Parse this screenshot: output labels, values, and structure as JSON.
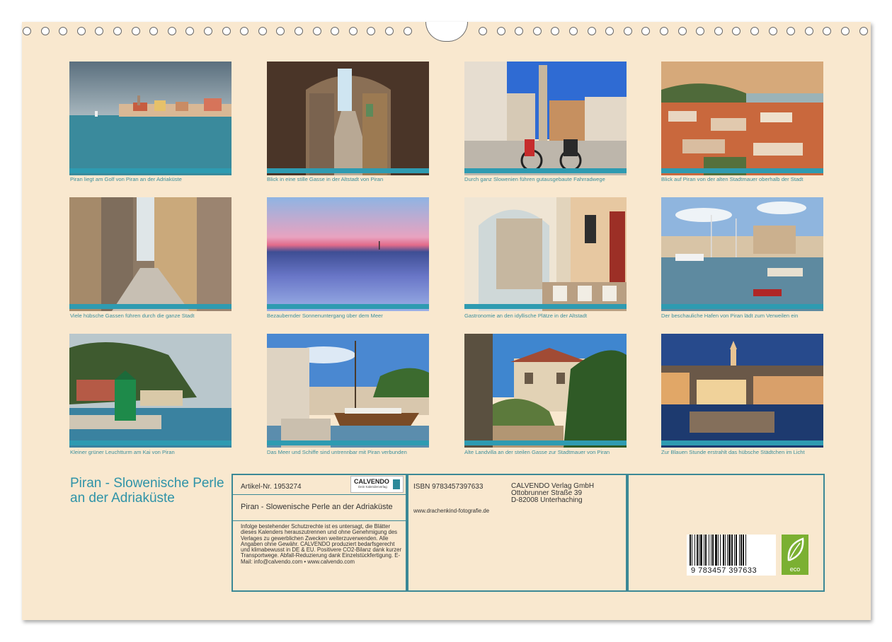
{
  "captions": [
    "Piran liegt am  Golf von Piran an der Adriaküste",
    "Blick in eine stille Gasse in der Altstadt von Piran",
    "Durch ganz Slowenien führen gutausgebaute Fahrradwege",
    "Blick auf Piran von der alten Stadtmauer oberhalb der Stadt",
    "Viele hübsche Gassen führen durch die ganze Stadt",
    "Bezaubernder Sonnenuntergang über dem Meer",
    "Gastronomie an den idyllische Plätze in der Altstadt",
    "Der beschauliche Hafen von Piran lädt zum Verweilen ein",
    "Kleiner grüner Leuchtturm am Kai von Piran",
    "Das Meer und Schiffe sind untrennbar mit Piran verbunden",
    "Alte Landvilla an der steilen Gasse zur Stadtmauer von Piran",
    "Zur Blauen Stunde erstrahlt das hübsche Städtchen im Licht"
  ],
  "title": "Piran - Slowenische Perle an der Adriaküste",
  "article_no": "Artikel-Nr. 1953274",
  "logo": {
    "brand": "CALVENDO",
    "tagline": "Dein Kalenderverlag"
  },
  "box_title": "Piran - Slowenische Perle an der Adriaküste",
  "legal": "Infolge bestehender Schutzrechte ist es untersagt, die Blätter dieses Kalenders herauszutrennen und ohne Genehmigung des Verlages zu gewerblichen Zwecken weiterzuverwenden. Alle Angaben ohne Gewähr. CALVENDO produziert bedarfsgerecht und klimabewusst in DE & EU. Positivere CO2-Bilanz dank kurzer Transportwege. Abfall-Reduzierung dank Einzelstückfertigung. E-Mail: info@calvendo.com • www.calvendo.com",
  "isbn": "ISBN 9783457397633",
  "website": "www.drachenkind-fotografie.de",
  "publisher": [
    "CALVENDO Verlag GmbH",
    "Ottobrunner Straße 39",
    "D-82008 Unterhaching"
  ],
  "barcode_number": "9 783457 397633",
  "eco_label": "eco",
  "colors": {
    "accent": "#3b8896",
    "sheet": "#f9e8cf",
    "title": "#2f93a8",
    "caption": "#3c8f9c"
  }
}
